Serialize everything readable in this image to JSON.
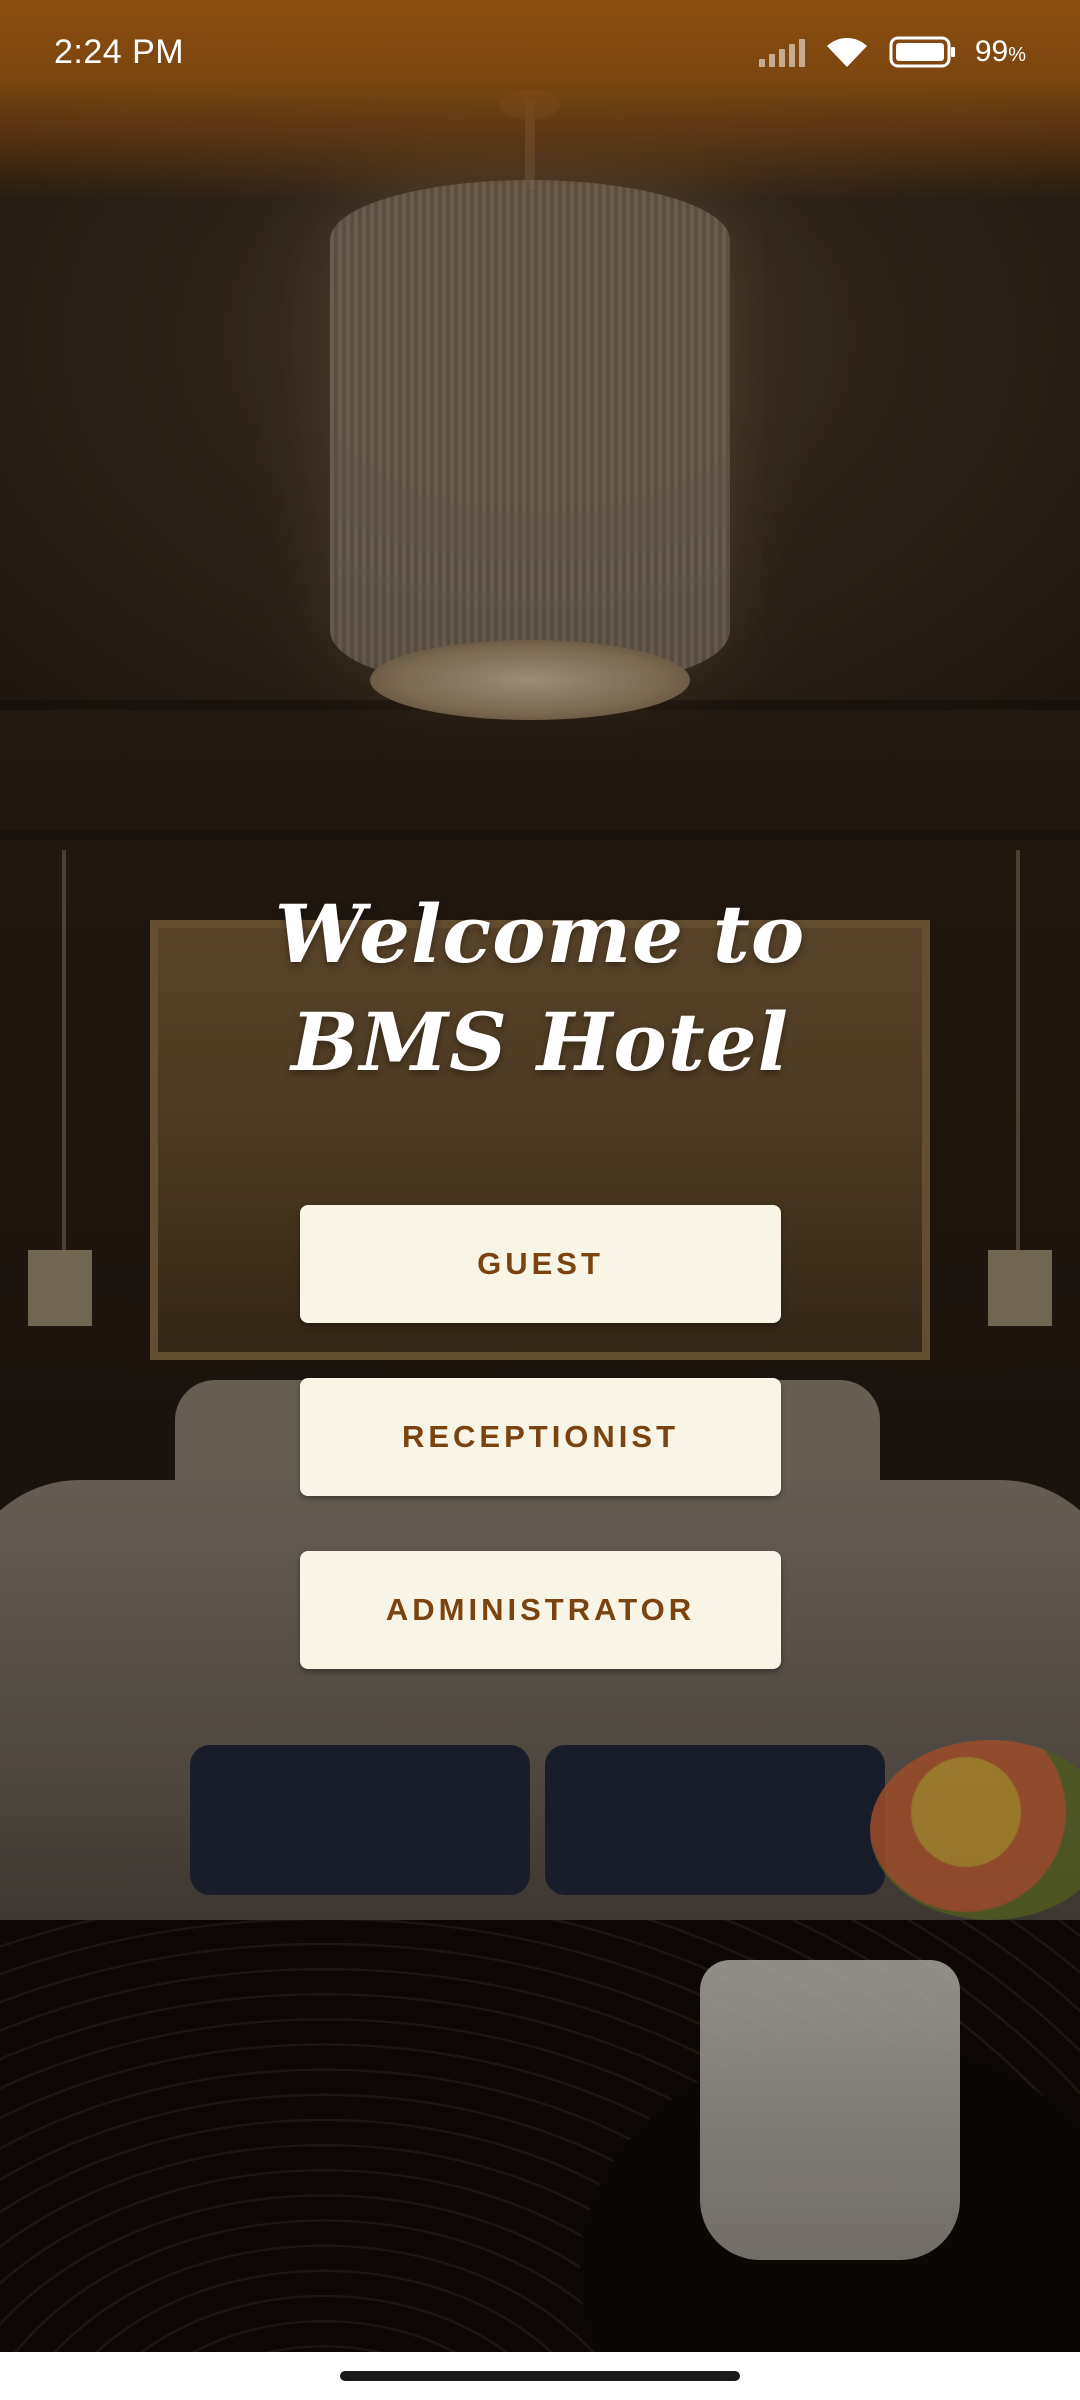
{
  "status_bar": {
    "time": "2:24 PM",
    "battery_percent": "99",
    "battery_unit": "%",
    "signal_icon": "cellular-signal-icon",
    "wifi_icon": "wifi-icon",
    "battery_icon": "battery-icon"
  },
  "welcome": {
    "line1": "Welcome to",
    "line2": "BMS Hotel"
  },
  "buttons": {
    "guest": "GUEST",
    "receptionist": "RECEPTIONIST",
    "administrator": "ADMINISTRATOR"
  },
  "colors": {
    "status_bar": "#8a4d0f",
    "button_bg": "#f8f5e6",
    "button_text": "#7a4310",
    "title_text": "#ffffff"
  },
  "background_image": "hotel-bedroom-photo"
}
